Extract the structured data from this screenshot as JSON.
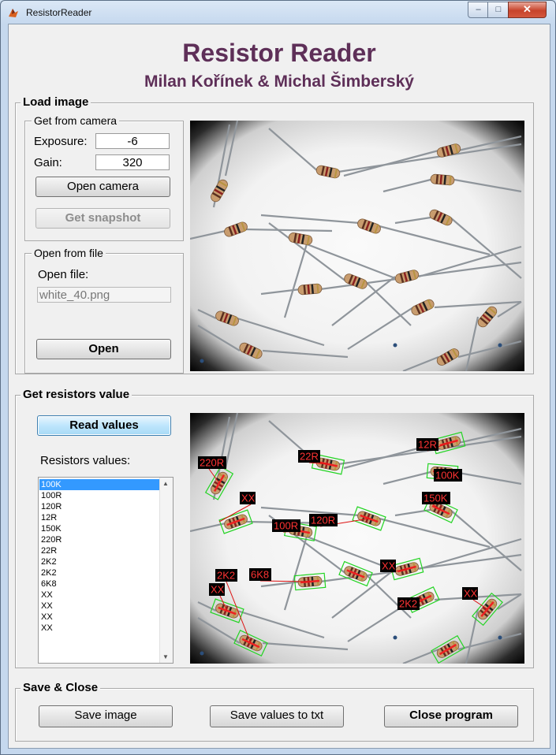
{
  "window": {
    "title": "ResistorReader",
    "minimize": "–",
    "maximize": "□",
    "close": "✕"
  },
  "header": {
    "title": "Resistor Reader",
    "authors": "Milan Kořínek & Michal Šimberský"
  },
  "load_image": {
    "legend": "Load image",
    "camera": {
      "legend": "Get from camera",
      "exposure_label": "Exposure:",
      "exposure_value": "-6",
      "gain_label": "Gain:",
      "gain_value": "320",
      "open_camera": "Open camera",
      "snapshot": "Get snapshot"
    },
    "file": {
      "legend": "Open from file",
      "open_file_label": "Open file:",
      "file_value": "white_40.png",
      "open_button": "Open"
    }
  },
  "get_values": {
    "legend": "Get resistors value",
    "read_button": "Read values",
    "list_label": "Resistors values:",
    "values": [
      "100K",
      "100R",
      "120R",
      "12R",
      "150K",
      "220R",
      "22R",
      "2K2",
      "2K2",
      "6K8",
      "XX",
      "XX",
      "XX",
      "XX"
    ],
    "selected_index": 0,
    "detection_labels": [
      "220R",
      "XX",
      "22R",
      "12R",
      "100K",
      "150K",
      "100R",
      "120R",
      "XX",
      "2K2",
      "6K8",
      "XX",
      "2K2",
      "XX"
    ]
  },
  "save_close": {
    "legend": "Save & Close",
    "save_image": "Save image",
    "save_txt": "Save values to txt",
    "close_program": "Close program"
  }
}
